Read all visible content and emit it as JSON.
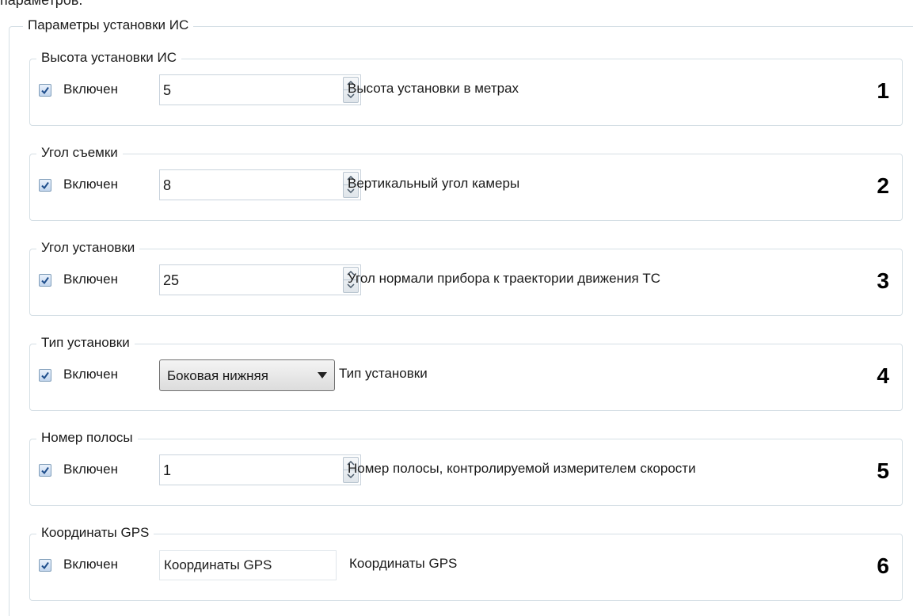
{
  "top_text": "параметров.",
  "panel": {
    "title": "Параметры установки ИС"
  },
  "groups": [
    {
      "title": "Высота установки ИС",
      "checkbox_label": "Включен",
      "checked": true,
      "control": "spin",
      "value": "5",
      "description": "Высота установки в метрах",
      "number": "1"
    },
    {
      "title": "Угол съемки",
      "checkbox_label": "Включен",
      "checked": true,
      "control": "spin",
      "value": "8",
      "description": "Вертикальный угол камеры",
      "number": "2"
    },
    {
      "title": "Угол установки",
      "checkbox_label": "Включен",
      "checked": true,
      "control": "spin",
      "value": "25",
      "description": "Угол нормали прибора к траектории движения ТС",
      "number": "3"
    },
    {
      "title": "Тип установки",
      "checkbox_label": "Включен",
      "checked": true,
      "control": "combo",
      "value": "Боковая нижняя",
      "description": "Тип установки",
      "number": "4"
    },
    {
      "title": "Номер полосы",
      "checkbox_label": "Включен",
      "checked": true,
      "control": "spin",
      "value": "1",
      "description": "Номер полосы, контролируемой измерителем скорости",
      "number": "5"
    },
    {
      "title": "Координаты GPS",
      "checkbox_label": "Включен",
      "checked": true,
      "control": "text",
      "value": "Координаты GPS",
      "description": "Координаты GPS",
      "number": "6"
    }
  ],
  "icons": {
    "checkbox": "checkmark-icon",
    "spin_up": "arrow-up-icon",
    "spin_down": "arrow-down-icon",
    "combo": "chevron-down-icon"
  },
  "colors": {
    "checkbox_fill": "#c3d6ee",
    "checkmark": "#1f4e8c",
    "border": "#d5dfe5"
  }
}
